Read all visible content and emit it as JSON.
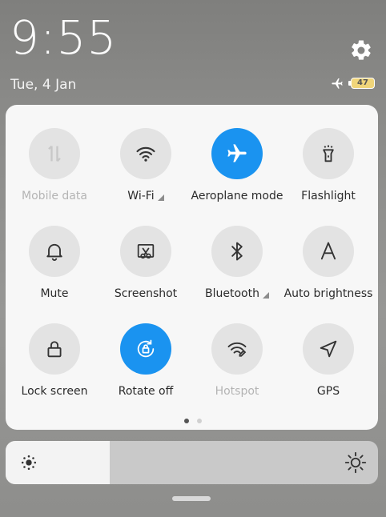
{
  "status_bar": {
    "time": "9:55",
    "date": "Tue, 4 Jan",
    "battery": "47",
    "icons": [
      "airplane-icon",
      "battery-icon",
      "gear-icon"
    ]
  },
  "tiles": [
    {
      "label": "Mobile data",
      "icon": "mobile-data-icon",
      "state": "disabled"
    },
    {
      "label": "Wi-Fi",
      "icon": "wifi-icon",
      "state": "off",
      "expandable": true
    },
    {
      "label": "Aeroplane mode",
      "icon": "airplane-icon",
      "state": "on"
    },
    {
      "label": "Flashlight",
      "icon": "flashlight-icon",
      "state": "off"
    },
    {
      "label": "Mute",
      "icon": "bell-icon",
      "state": "off"
    },
    {
      "label": "Screenshot",
      "icon": "screenshot-icon",
      "state": "off"
    },
    {
      "label": "Bluetooth",
      "icon": "bluetooth-icon",
      "state": "off",
      "expandable": true
    },
    {
      "label": "Auto brightness",
      "icon": "auto-brightness-icon",
      "state": "off"
    },
    {
      "label": "Lock screen",
      "icon": "lock-icon",
      "state": "off"
    },
    {
      "label": "Rotate off",
      "icon": "rotate-lock-icon",
      "state": "on"
    },
    {
      "label": "Hotspot",
      "icon": "hotspot-icon",
      "state": "disabled"
    },
    {
      "label": "GPS",
      "icon": "gps-icon",
      "state": "off"
    }
  ],
  "pager": {
    "pages": 2,
    "current": 1
  },
  "brightness": {
    "level": 0.28
  },
  "colors": {
    "accent": "#1a93f0",
    "tile_off": "#e3e3e3",
    "panel": "#f7f7f7"
  }
}
